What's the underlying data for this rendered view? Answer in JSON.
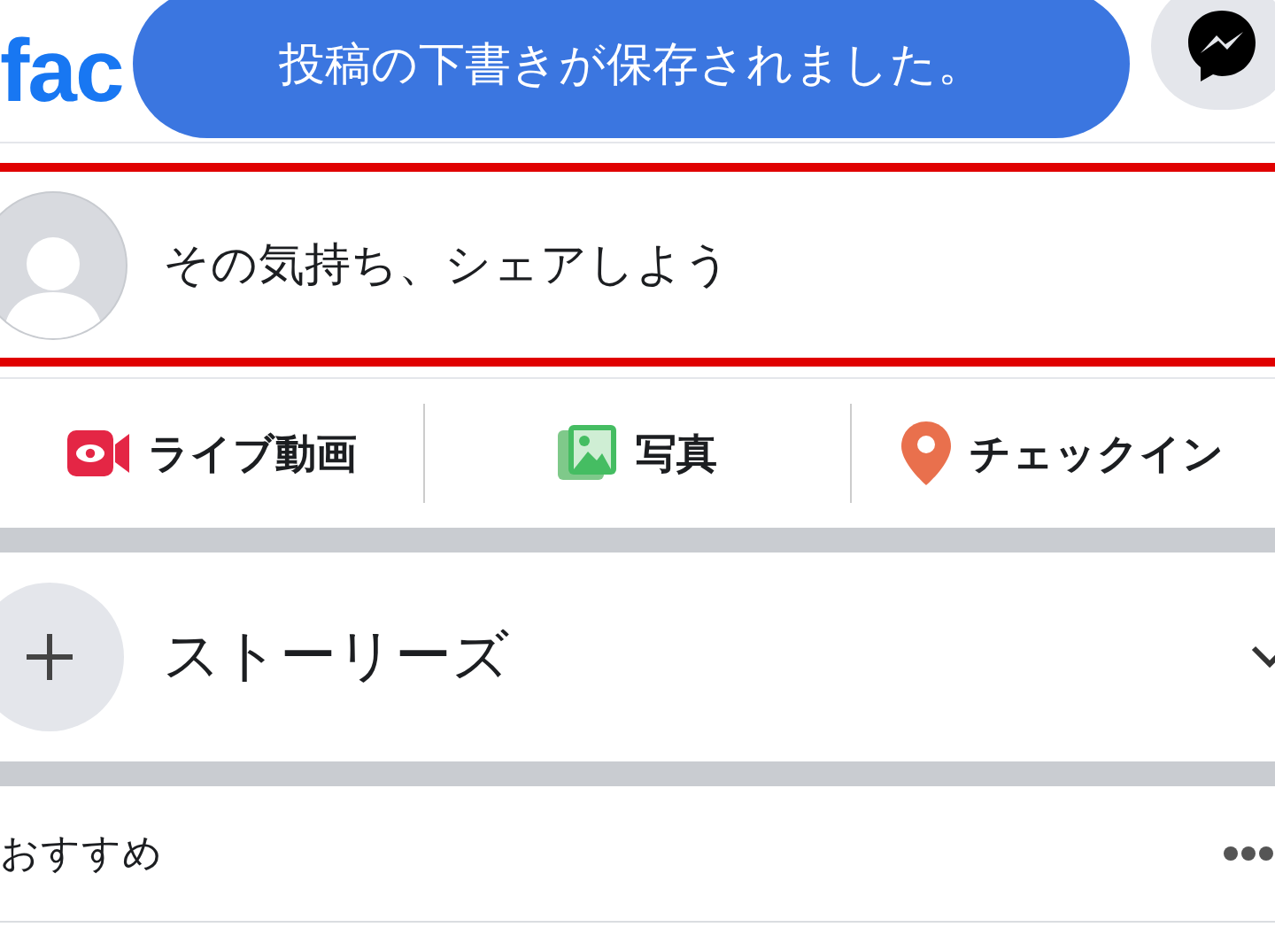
{
  "header": {
    "logo": "fac",
    "toast": "投稿の下書きが保存されました。"
  },
  "composer": {
    "placeholder": "その気持ち、シェアしよう"
  },
  "actions": [
    {
      "kind": "live",
      "label": "ライブ動画"
    },
    {
      "kind": "photo",
      "label": "写真"
    },
    {
      "kind": "checkin",
      "label": "チェックイン"
    }
  ],
  "stories": {
    "title": "ストーリーズ"
  },
  "feed_section": {
    "title": "おすすめ"
  }
}
